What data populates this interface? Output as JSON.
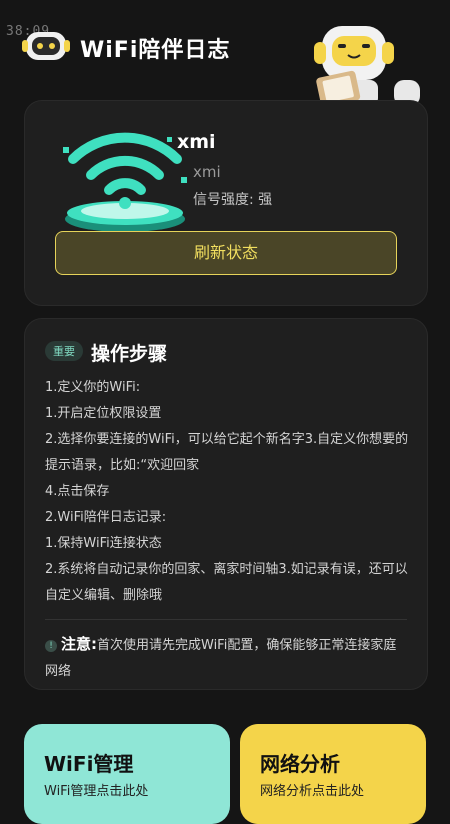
{
  "status": {
    "time": "38:09"
  },
  "header": {
    "title": "WiFi陪伴日志"
  },
  "wifi_card": {
    "name": "xmi",
    "sub_name": "xmi",
    "signal_label": "信号强度: 强",
    "refresh_label": "刷新状态"
  },
  "steps": {
    "badge": "重要",
    "title": "操作步骤",
    "lines": [
      "1.定义你的WiFi:",
      "1.开启定位权限设置",
      "2.选择你要连接的WiFi，可以给它起个新名字3.自定义你想要的提示语录，比如:“欢迎回家",
      "4.点击保存",
      "2.WiFi陪伴日志记录:",
      "1.保持WiFi连接状态",
      "2.系统将自动记录你的回家、离家时间轴3.如记录有误，还可以自定义编辑、删除哦"
    ],
    "note_label": "注意:",
    "note_text": "首次使用请先完成WiFi配置，确保能够正常连接家庭网络"
  },
  "tiles": {
    "wifi": {
      "title": "WiFi管理",
      "sub": "WiFi管理点击此处"
    },
    "net": {
      "title": "网络分析",
      "sub": "网络分析点击此处"
    }
  },
  "colors": {
    "accent_yellow": "#f4d44a",
    "accent_teal": "#8fe6d6",
    "background": "#151515"
  }
}
